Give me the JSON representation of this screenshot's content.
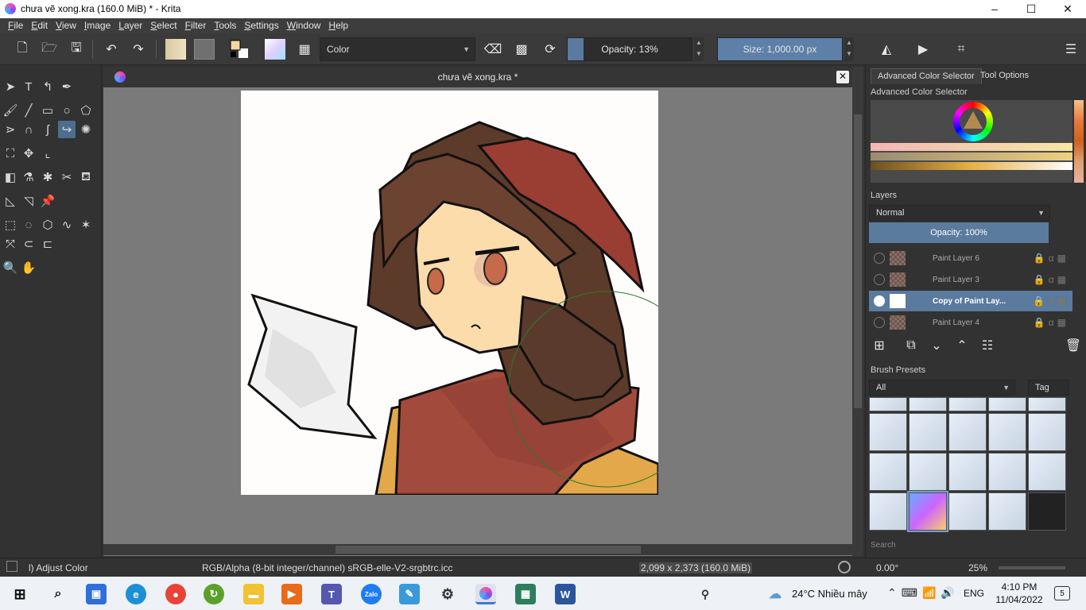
{
  "window": {
    "title": "chưa vẽ xong.kra (160.0 MiB)  * - Krita",
    "minimize": "–",
    "maximize": "☐",
    "close": "✕"
  },
  "menu": [
    "File",
    "Edit",
    "View",
    "Image",
    "Layer",
    "Select",
    "Filter",
    "Tools",
    "Settings",
    "Window",
    "Help"
  ],
  "toolbar": {
    "blend_mode": "Color",
    "opacity_label": "Opacity: 13%",
    "opacity_value": 0.13,
    "size_label": "Size: 1,000.00 px"
  },
  "document": {
    "tab_title": "chưa vẽ xong.kra *",
    "close": "✕"
  },
  "docker": {
    "tabs": [
      "Advanced Color Selector",
      "Tool Options"
    ],
    "color_selector_title": "Advanced Color Selector",
    "layers_title": "Layers",
    "layer_blend": "Normal",
    "layer_opacity": "Opacity:  100%",
    "layers": [
      {
        "name": "Paint Layer 6",
        "selected": false
      },
      {
        "name": "Paint Layer 3",
        "selected": false
      },
      {
        "name": "Copy of Paint Lay...",
        "selected": true
      },
      {
        "name": "Paint Layer 4",
        "selected": false
      }
    ],
    "brush_presets_title": "Brush Presets",
    "brush_filter": "All",
    "tag_label": "Tag",
    "search_placeholder": "Search"
  },
  "status": {
    "tool": "l) Adjust Color",
    "color_space": "RGB/Alpha (8-bit integer/channel)  sRGB-elle-V2-srgbtrc.icc",
    "dimensions": "2,099 x 2,373 (160.0 MiB)",
    "rotation": "0.00°",
    "zoom": "25%"
  },
  "taskbar": {
    "weather": "24°C  Nhiều mây",
    "language": "ENG",
    "time": "4:10 PM",
    "date": "11/04/2022",
    "notifications": "5"
  },
  "colors": {
    "accent": "#5a7a9e",
    "size_slider": "#5d7fa8"
  }
}
